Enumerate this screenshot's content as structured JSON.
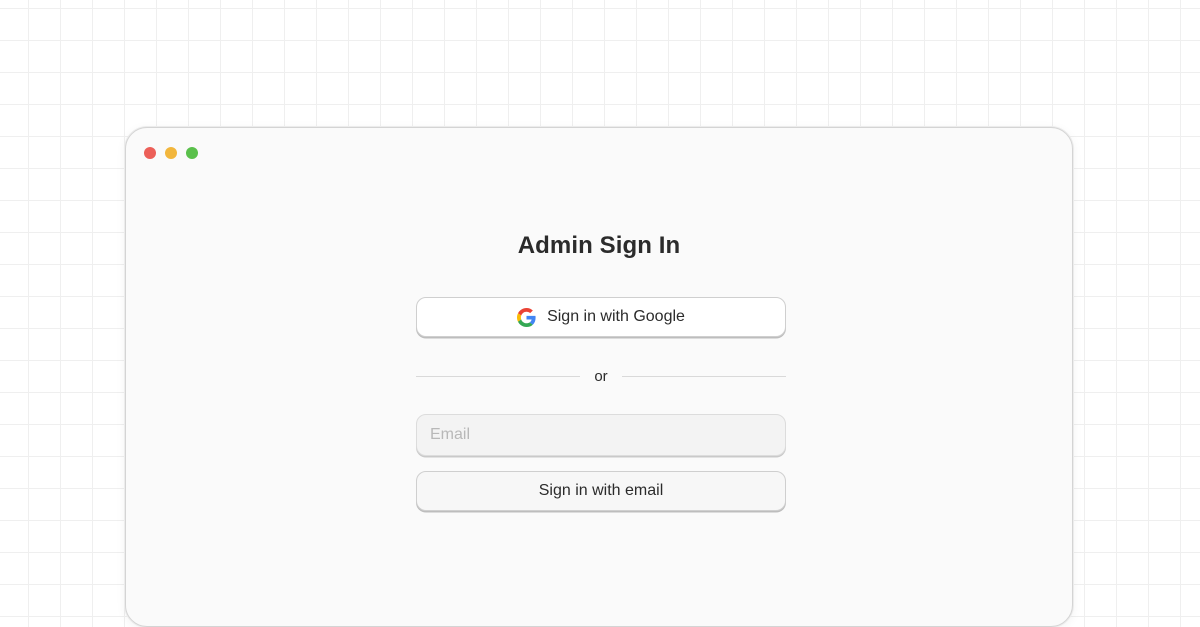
{
  "window": {
    "controls": [
      "close",
      "minimize",
      "maximize"
    ]
  },
  "signin": {
    "title": "Admin Sign In",
    "google_button_label": "Sign in with Google",
    "divider_text": "or",
    "email_input": {
      "placeholder": "Email",
      "value": ""
    },
    "email_button_label": "Sign in with email"
  },
  "icons": {
    "google": "google-g-icon"
  },
  "colors": {
    "close": "#ec5f58",
    "minimize": "#f2b63c",
    "maximize": "#5ac04b",
    "text": "#2b2b2b",
    "window_bg": "#fafafa"
  }
}
